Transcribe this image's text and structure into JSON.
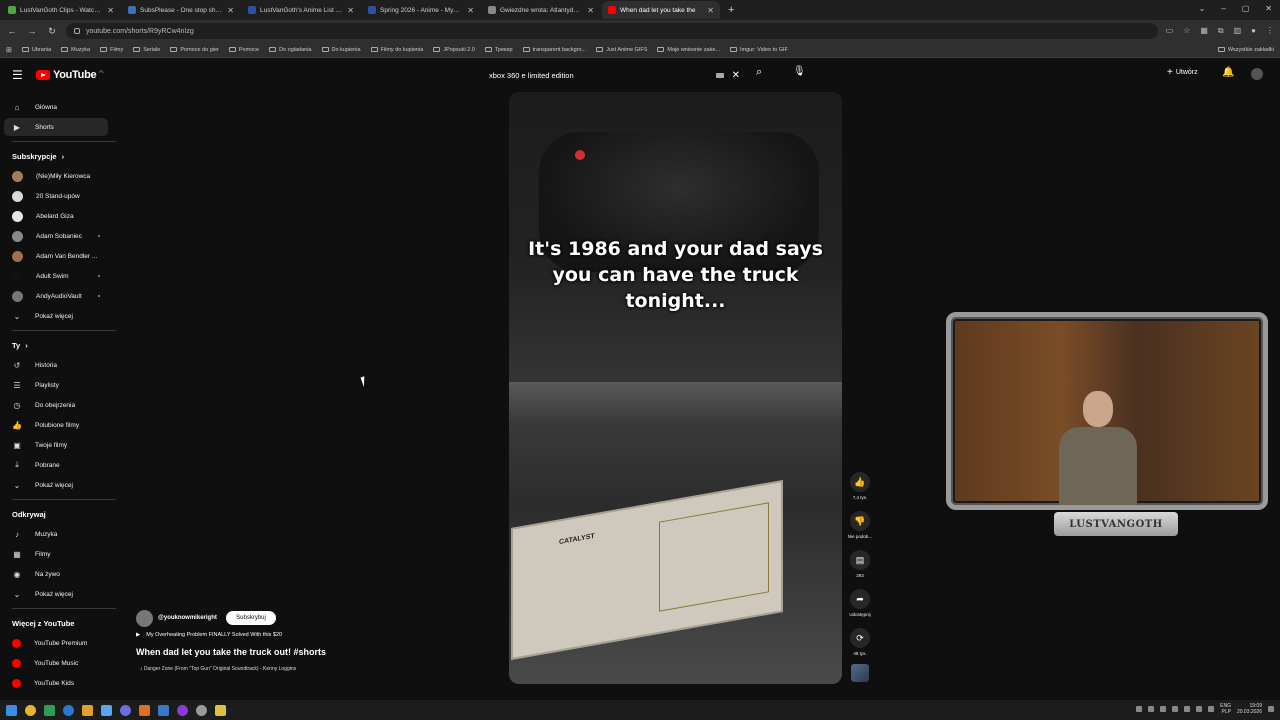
{
  "browser": {
    "tabs": [
      {
        "title": "LustVanGoth Clips - Watch Liv",
        "color": "#53a345",
        "active": false
      },
      {
        "title": "SubsPlease - One stop shop fo",
        "color": "#3f6fb5",
        "active": false
      },
      {
        "title": "LustVanGoth's Anime List - My",
        "color": "#2e51a2",
        "active": false
      },
      {
        "title": "Spring 2026 - Anime - MyAnim",
        "color": "#2e51a2",
        "active": false
      },
      {
        "title": "Gwiezdne wrota: Atlantyda / St",
        "color": "#888888",
        "active": false
      },
      {
        "title": "When dad let you take the",
        "color": "#ff0000",
        "active": true
      }
    ],
    "new_tab": "+",
    "url": "youtube.com/shorts/R9yRCw4nIzg",
    "bookmarks": [
      "Ubrania",
      "Muzyka",
      "Filmy",
      "Seriale",
      "Pomoce do gier",
      "Pomoce",
      "Do ogladania",
      "Do kupienia",
      "Filmy do kupienia",
      "JPopsuki 2.0",
      "Трекер",
      "transparent backgro...",
      "Just Anime GIFS",
      "Moje wniesnie zake...",
      "Imgur: Video to GIF"
    ],
    "bookmarks_all": "Wszystkie zakładki"
  },
  "header": {
    "logo": "YouTube",
    "country": "PL",
    "search_value": "xbox 360 e limited edition",
    "create_label": "Utwórz"
  },
  "sidebar": {
    "main": [
      {
        "label": "Główna",
        "icon": "home-icon",
        "glyph": "⌂"
      },
      {
        "label": "Shorts",
        "icon": "shorts-icon",
        "glyph": "▶"
      }
    ],
    "subs_heading": "Subskrypcje",
    "subs": [
      {
        "label": "(Nie)Miły Kierowca",
        "color": "#a0805a",
        "dot": false
      },
      {
        "label": "20 Stand-upów",
        "color": "#d8d8d8",
        "dot": false
      },
      {
        "label": "Abelard Giza",
        "color": "#e6e6e6",
        "dot": false
      },
      {
        "label": "Adam Sobaniec",
        "color": "#888888",
        "dot": true
      },
      {
        "label": "Adam Van Bendler ...",
        "color": "#a07050",
        "dot": false
      },
      {
        "label": "Adult Swim",
        "color": "#111111",
        "dot": true
      },
      {
        "label": "AndyAudioVault",
        "color": "#777777",
        "dot": true
      }
    ],
    "subs_more": "Pokaż więcej",
    "you_heading": "Ty",
    "you": [
      {
        "label": "Historia",
        "glyph": "↺"
      },
      {
        "label": "Playlisty",
        "glyph": "☰"
      },
      {
        "label": "Do obejrzenia",
        "glyph": "◷"
      },
      {
        "label": "Polubione filmy",
        "glyph": "👍"
      },
      {
        "label": "Twoje filmy",
        "glyph": "▣"
      },
      {
        "label": "Pobrane",
        "glyph": "⤓"
      }
    ],
    "you_more": "Pokaż więcej",
    "explore_heading": "Odkrywaj",
    "explore": [
      {
        "label": "Muzyka",
        "glyph": "♪"
      },
      {
        "label": "Filmy",
        "glyph": "▦"
      },
      {
        "label": "Na żywo",
        "glyph": "◉"
      }
    ],
    "explore_more": "Pokaż więcej",
    "more_heading": "Więcej z YouTube",
    "more": [
      {
        "label": "YouTube Premium",
        "color": "#ff0000"
      },
      {
        "label": "YouTube Music",
        "color": "#ff0000"
      },
      {
        "label": "YouTube Kids",
        "color": "#ff0000"
      }
    ]
  },
  "short": {
    "caption": "It's 1986 and your dad says you can have the truck tonight...",
    "sticker_text": "CATALYST",
    "channel": "@youknowmikeright",
    "subscribe": "Subskrybuj",
    "related": "My Overheating Problem FINALLY Solved With this $20",
    "title": "When dad let you take the truck out! #shorts",
    "song": "♪ Danger Zone (From \"Top Gun\" Original Soundtrack) - Kenny Loggins",
    "actions": {
      "likes": "7,4 tys.",
      "dislike": "Nie podob...",
      "comments": "293",
      "share": "Udostępnij",
      "remix": "48 tys."
    }
  },
  "overlay": {
    "cam_label": "LUSTVANGOTH"
  },
  "taskbar": {
    "lang": "ENG",
    "lang2": "PLP",
    "time": "19:09",
    "date": "20.03.2026"
  }
}
